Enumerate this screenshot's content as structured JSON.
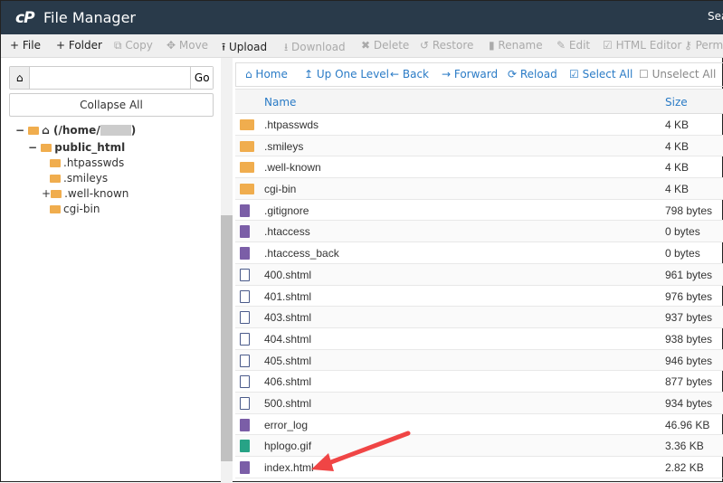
{
  "header": {
    "logo": "cP",
    "title": "File Manager",
    "search": "Sea"
  },
  "toolbar": [
    {
      "label": "+ File",
      "enabled": true
    },
    {
      "label": "+ Folder",
      "enabled": true
    },
    {
      "label": "⧉ Copy",
      "enabled": false
    },
    {
      "label": "✥ Move",
      "enabled": false
    },
    {
      "label": "⭱ Upload",
      "enabled": true
    },
    {
      "label": "⭳ Download",
      "enabled": false
    },
    {
      "label": "✖ Delete",
      "enabled": false
    },
    {
      "label": "↺ Restore",
      "enabled": false
    },
    {
      "label": "▮ Rename",
      "enabled": false
    },
    {
      "label": "✎ Edit",
      "enabled": false
    },
    {
      "label": "☑ HTML Editor",
      "enabled": false
    },
    {
      "label": "⚷ Perm",
      "enabled": false
    }
  ],
  "left": {
    "path_value": "",
    "go": "Go",
    "collapse": "Collapse All",
    "tree": {
      "root": "(/home/",
      "root_end": ")",
      "public": "public_html",
      "children": [
        ".htpasswds",
        ".smileys",
        ".well-known",
        "cgi-bin"
      ]
    }
  },
  "nav": [
    {
      "label": "⌂ Home"
    },
    {
      "label": "↥ Up One Level"
    },
    {
      "label": "← Back"
    },
    {
      "label": "→ Forward"
    },
    {
      "label": "⟳ Reload"
    },
    {
      "label": "☑ Select All"
    },
    {
      "label": "☐ Unselect All"
    }
  ],
  "table": {
    "headers": {
      "name": "Name",
      "size": "Size"
    },
    "rows": [
      {
        "name": ".htpasswds",
        "size": "4 KB",
        "type": "folder"
      },
      {
        "name": ".smileys",
        "size": "4 KB",
        "type": "folder"
      },
      {
        "name": ".well-known",
        "size": "4 KB",
        "type": "folder"
      },
      {
        "name": "cgi-bin",
        "size": "4 KB",
        "type": "folder"
      },
      {
        "name": ".gitignore",
        "size": "798 bytes",
        "type": "text"
      },
      {
        "name": ".htaccess",
        "size": "0 bytes",
        "type": "text"
      },
      {
        "name": ".htaccess_back",
        "size": "0 bytes",
        "type": "text"
      },
      {
        "name": "400.shtml",
        "size": "961 bytes",
        "type": "code"
      },
      {
        "name": "401.shtml",
        "size": "976 bytes",
        "type": "code"
      },
      {
        "name": "403.shtml",
        "size": "937 bytes",
        "type": "code"
      },
      {
        "name": "404.shtml",
        "size": "938 bytes",
        "type": "code"
      },
      {
        "name": "405.shtml",
        "size": "946 bytes",
        "type": "code"
      },
      {
        "name": "406.shtml",
        "size": "877 bytes",
        "type": "code"
      },
      {
        "name": "500.shtml",
        "size": "934 bytes",
        "type": "code"
      },
      {
        "name": "error_log",
        "size": "46.96 KB",
        "type": "text"
      },
      {
        "name": "hplogo.gif",
        "size": "3.36 KB",
        "type": "image"
      },
      {
        "name": "index.html",
        "size": "2.82 KB",
        "type": "text"
      }
    ]
  },
  "colors": {
    "header": "#293a4a",
    "link": "#2a7bc6",
    "folder": "#f0ad4e",
    "text_file": "#7b5ea7",
    "code_file": "#4a5a8a",
    "image_file": "#27a386",
    "arrow": "#f04545"
  }
}
